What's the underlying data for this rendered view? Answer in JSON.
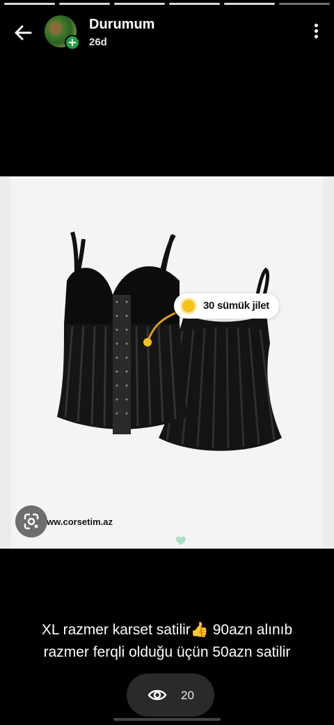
{
  "story": {
    "username": "Durumum",
    "time_ago": "26d",
    "caption_line1": "XL razmer karset satilir👍 90azn alınıb",
    "caption_line2": "razmer ferqli olduğu üçün 50azn satilir",
    "views": "20"
  },
  "image": {
    "tag_label": "30 sümük jilet",
    "website": "www.corsetim.az"
  },
  "icons": {
    "back": "back-arrow-icon",
    "menu": "more-vertical-icon",
    "add": "plus-icon",
    "lens": "google-lens-icon",
    "eye": "eye-icon",
    "heart": "heart-icon"
  },
  "colors": {
    "background": "#000000",
    "accent_green": "#25a244",
    "tag_dot": "#f6c21a"
  }
}
